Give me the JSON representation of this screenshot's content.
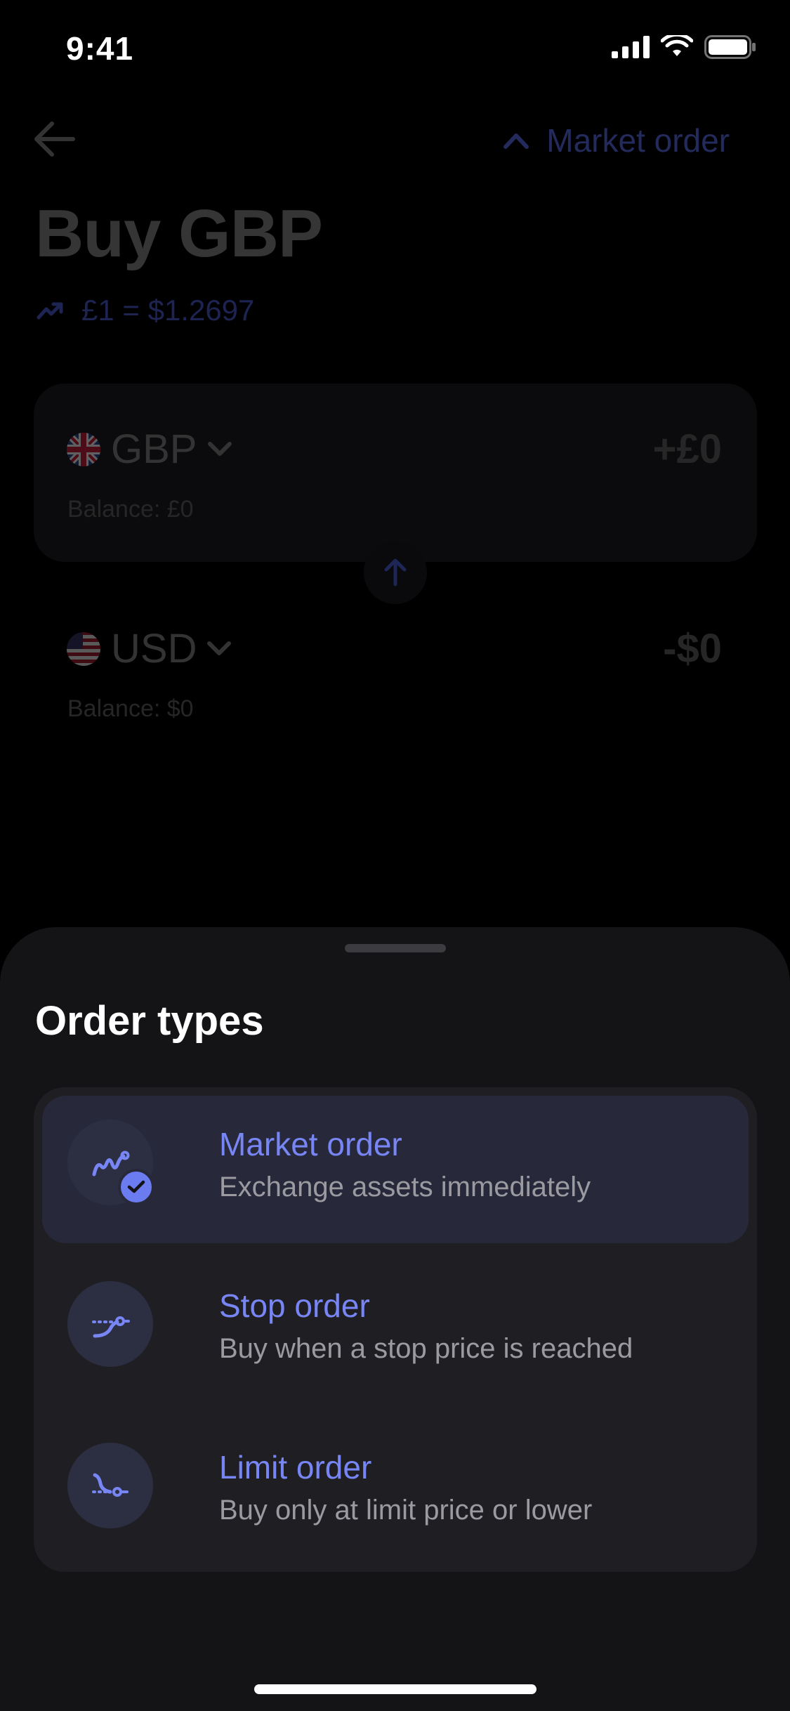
{
  "status_bar": {
    "time": "9:41",
    "icons": [
      "cellular-signal-icon",
      "wifi-icon",
      "battery-icon"
    ]
  },
  "header": {
    "back_icon": "arrow-left-icon",
    "order_toggle_icon": "chevron-up-icon",
    "order_toggle_label": "Market order"
  },
  "exchange": {
    "title": "Buy GBP",
    "rate_icon": "trending-up-icon",
    "rate": "£1 = $1.2697",
    "from": {
      "flag": "uk-flag-icon",
      "currency": "GBP",
      "amount": "+£0",
      "balance": "Balance: £0"
    },
    "swap_icon": "arrow-up-icon",
    "to": {
      "flag": "us-flag-icon",
      "currency": "USD",
      "amount": "-$0",
      "balance": "Balance: $0"
    }
  },
  "sheet": {
    "title": "Order types",
    "options": [
      {
        "title": "Market order",
        "description": "Exchange assets immediately",
        "icon": "market-order-icon",
        "selected": true
      },
      {
        "title": "Stop order",
        "description": "Buy when a stop price is reached",
        "icon": "stop-order-icon",
        "selected": false
      },
      {
        "title": "Limit order",
        "description": "Buy only at limit price or lower",
        "icon": "limit-order-icon",
        "selected": false
      }
    ]
  },
  "colors": {
    "accent": "#7886f5",
    "sheet_background": "#141416",
    "card_background": "#1f1f23",
    "selected_background": "#27283a"
  }
}
